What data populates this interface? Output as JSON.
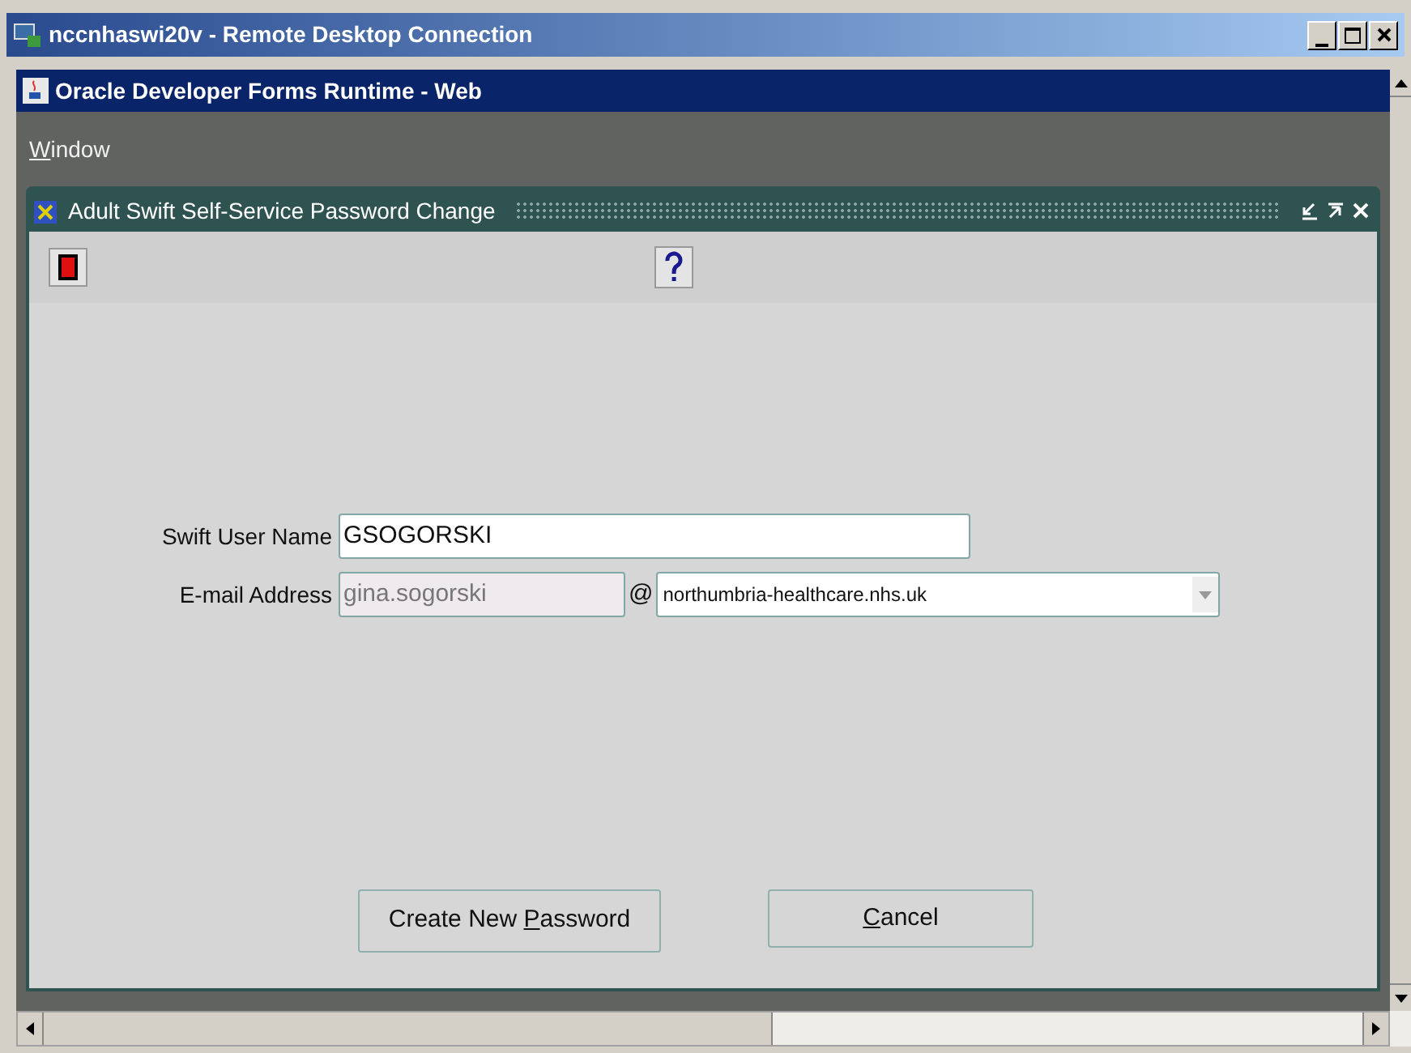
{
  "window": {
    "title": "nccnhaswi20v - Remote Desktop Connection"
  },
  "browser": {
    "title": "Oracle Developer Forms Runtime - Web"
  },
  "menu": [
    {
      "mnemonic": "W",
      "after": "indow"
    }
  ],
  "form": {
    "title": "Adult Swift Self-Service Password Change",
    "fields": [
      {
        "kind": "text",
        "label": "Swift User Name",
        "value": "GSOGORSKI",
        "disabled": false
      },
      {
        "kind": "email",
        "label": "E-mail Address",
        "value": "gina.sogorski",
        "disabled": true,
        "at": "@",
        "domain": "northumbria-healthcare.nhs.uk"
      }
    ],
    "buttons": [
      {
        "before": "Create New ",
        "mnemonic": "P",
        "after": "assword"
      },
      {
        "mnemonic": "C",
        "after": "ancel"
      }
    ]
  }
}
